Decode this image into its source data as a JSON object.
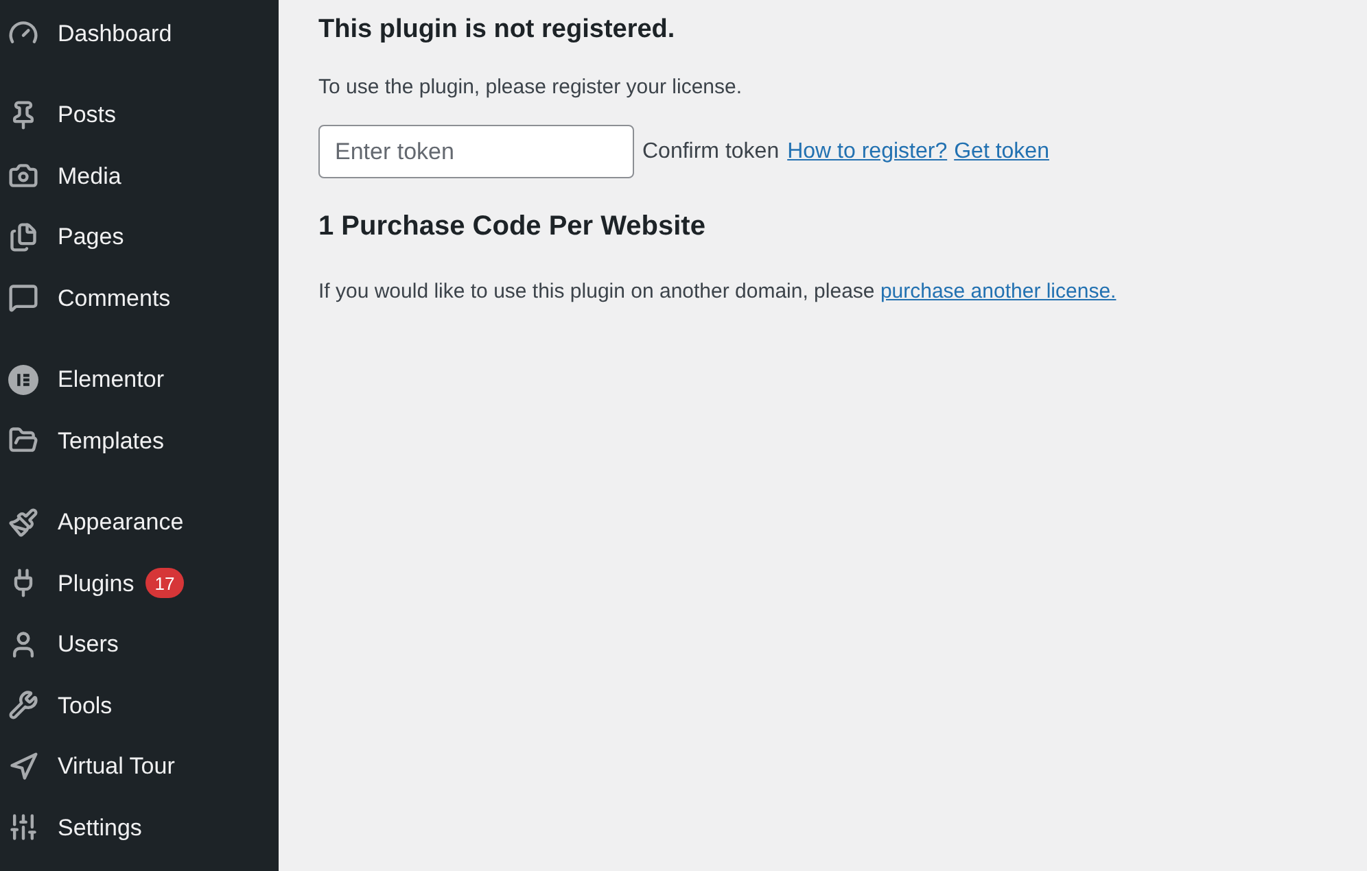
{
  "sidebar": {
    "groups": [
      [
        {
          "label": "Dashboard"
        }
      ],
      [
        {
          "label": "Posts"
        },
        {
          "label": "Media"
        },
        {
          "label": "Pages"
        },
        {
          "label": "Comments"
        }
      ],
      [
        {
          "label": "Elementor"
        },
        {
          "label": "Templates"
        }
      ],
      [
        {
          "label": "Appearance"
        },
        {
          "label": "Plugins",
          "badge": "17"
        },
        {
          "label": "Users"
        },
        {
          "label": "Tools"
        },
        {
          "label": "Virtual Tour"
        },
        {
          "label": "Settings"
        }
      ]
    ]
  },
  "main": {
    "title": "This plugin is not registered.",
    "intro": "To use the plugin, please register your license.",
    "token_field": {
      "placeholder": "Enter token"
    },
    "confirm": "Confirm token",
    "links": [
      "How to register?",
      "Get token"
    ],
    "subtitle": "1 Purchase Code Per Website",
    "note": "If you would like to use this plugin on another domain, please ",
    "note_link": "purchase another license."
  }
}
